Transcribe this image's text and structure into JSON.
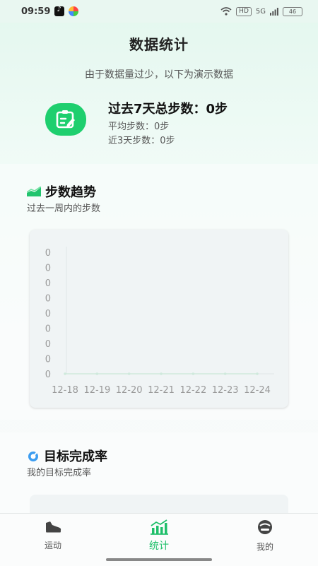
{
  "status_bar": {
    "time": "09:59",
    "signal_label": "5G",
    "hd_label": "HD",
    "battery": "46"
  },
  "header": {
    "title": "数据统计",
    "notice": "由于数据量过少，以下为演示数据"
  },
  "summary": {
    "total_label": "过去7天总步数：",
    "total_value": "0步",
    "avg_label": "平均步数：",
    "avg_value": "0步",
    "recent_label": "近3天步数：",
    "recent_value": "0步",
    "icon": "clipboard-edit-icon",
    "icon_color": "#1ecf6e"
  },
  "trend_section": {
    "title": "步数趋势",
    "subtitle": "过去一周内的步数",
    "icon": "trend-chart-icon"
  },
  "chart_data": {
    "type": "line",
    "categories": [
      "12-18",
      "12-19",
      "12-20",
      "12-21",
      "12-22",
      "12-23",
      "12-24"
    ],
    "values": [
      0,
      0,
      0,
      0,
      0,
      0,
      0
    ],
    "y_tick_labels": [
      "0",
      "0",
      "0",
      "0",
      "0",
      "0",
      "0",
      "0",
      "0"
    ],
    "ylim": [
      0,
      0
    ],
    "title": "",
    "xlabel": "",
    "ylabel": "",
    "grid": false
  },
  "goal_section": {
    "title": "目标完成率",
    "subtitle": "我的目标完成率",
    "icon": "target-gauge-icon"
  },
  "tabs": [
    {
      "label": "运动",
      "icon": "shoe-icon",
      "active": false
    },
    {
      "label": "统计",
      "icon": "bar-chart-icon",
      "active": true
    },
    {
      "label": "我的",
      "icon": "profile-icon",
      "active": false
    }
  ],
  "colors": {
    "accent": "#1fbf6a",
    "inactive": "#555555"
  }
}
